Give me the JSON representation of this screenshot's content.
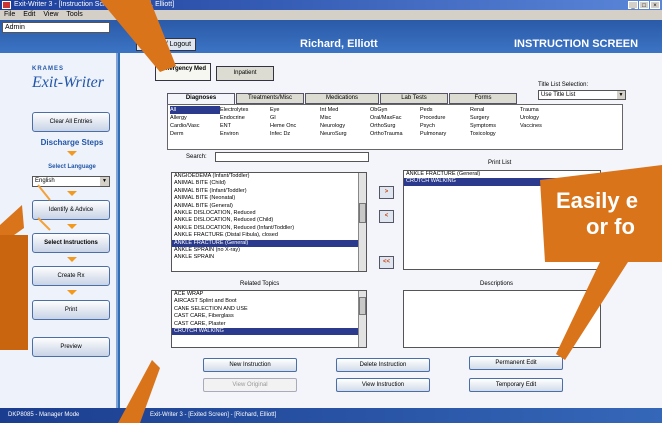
{
  "window": {
    "title": "Exit-Writer 3 - [Instruction Screen] - [Richard, Elliott]",
    "buttons": [
      "_",
      "□",
      "×"
    ]
  },
  "menu": [
    "File",
    "Edit",
    "View",
    "Tools"
  ],
  "header": {
    "user": "Admin",
    "logout_label": "User / Logout",
    "patient": "Richard, Elliott",
    "screen_title": "INSTRUCTION SCREEN"
  },
  "sidebar": {
    "brand_small": "KRAMES",
    "brand": "Exit-Writer",
    "clear_all": "Clear All Entries",
    "steps_heading": "Discharge Steps",
    "select_language": "Select Language",
    "language": "English",
    "identify": "Identify & Advice",
    "select_instructions": "Select Instructions",
    "create_rx": "Create Rx",
    "print": "Print",
    "preview": "Preview"
  },
  "care_tabs": {
    "emergency": "Emergency Med",
    "inpatient": "Inpatient"
  },
  "title_list_selection": {
    "label": "Title List Selection:",
    "value": "Use Title List"
  },
  "content_tabs": [
    "Diagnoses",
    "Treatments/Misc",
    "Medications",
    "Lab Tests",
    "Forms"
  ],
  "categories": [
    "All",
    "Electrolytes",
    "Eye",
    "Int Med",
    "ObGyn",
    "Peds",
    "Renal",
    "Trauma",
    "",
    "Allergy",
    "Endocrine",
    "GI",
    "Misc",
    "Oral/MaxFac",
    "Procedure",
    "Surgery",
    "Urology",
    "",
    "Cardio/Vasc",
    "ENT",
    "Heme Onc",
    "Neurology",
    "OrthoSurg",
    "Psych",
    "Symptoms",
    "Vaccines",
    "",
    "Derm",
    "Environ",
    "Infec Dz",
    "NeuroSurg",
    "OrthoTrauma",
    "Pulmonary",
    "Toxicology",
    "",
    ""
  ],
  "search": {
    "label": "Search:",
    "value": ""
  },
  "title_list": [
    "ANGIOEDEMA (Infant/Toddler)",
    "ANIMAL BITE (Child)",
    "ANIMAL BITE (Infant/Toddler)",
    "ANIMAL BITE (Neonatal)",
    "ANIMAL BITE (General)",
    "ANKLE DISLOCATION, Reduced",
    "ANKLE DISLOCATION, Reduced (Child)",
    "ANKLE DISLOCATION, Reduced (Infant/Toddler)",
    "ANKLE FRACTURE (Distal Fibula), closed",
    "ANKLE FRACTURE (General)",
    "ANKLE SPRAIN (no X-ray)",
    "ANKLE SPRAIN"
  ],
  "print_list": {
    "label": "Print List",
    "items": [
      "ANKLE FRACTURE (General)",
      "CRUTCH WALKING"
    ]
  },
  "move_buttons": [
    ">",
    "<",
    "<<"
  ],
  "related_topics": {
    "label": "Related Topics",
    "items": [
      "ACE WRAP",
      "AIRCAST Splint and Boot",
      "CANE SELECTION AND USE",
      "CAST CARE, Fiberglass",
      "CAST CARE, Plaster",
      "CRUTCH WALKING"
    ]
  },
  "descriptions": {
    "label": "Descriptions"
  },
  "actions": {
    "new_instruction": "New Instruction",
    "delete_instruction": "Delete Instruction",
    "permanent_edit": "Permanent Edit",
    "view_original": "View Original",
    "view_instruction": "View Instruction",
    "temporary_edit": "Temporary Edit"
  },
  "status": {
    "left": "DKP8085 - Manager Mode",
    "right": "Exit-Writer 3 - [Exited Screen] - [Richard, Elliott]"
  },
  "callout": {
    "line1": "Easily e",
    "line2": "or fo"
  },
  "colors": {
    "accent_orange": "#e07a18",
    "header_blue": "#2a5aa8",
    "selection": "#2b3a8c"
  }
}
